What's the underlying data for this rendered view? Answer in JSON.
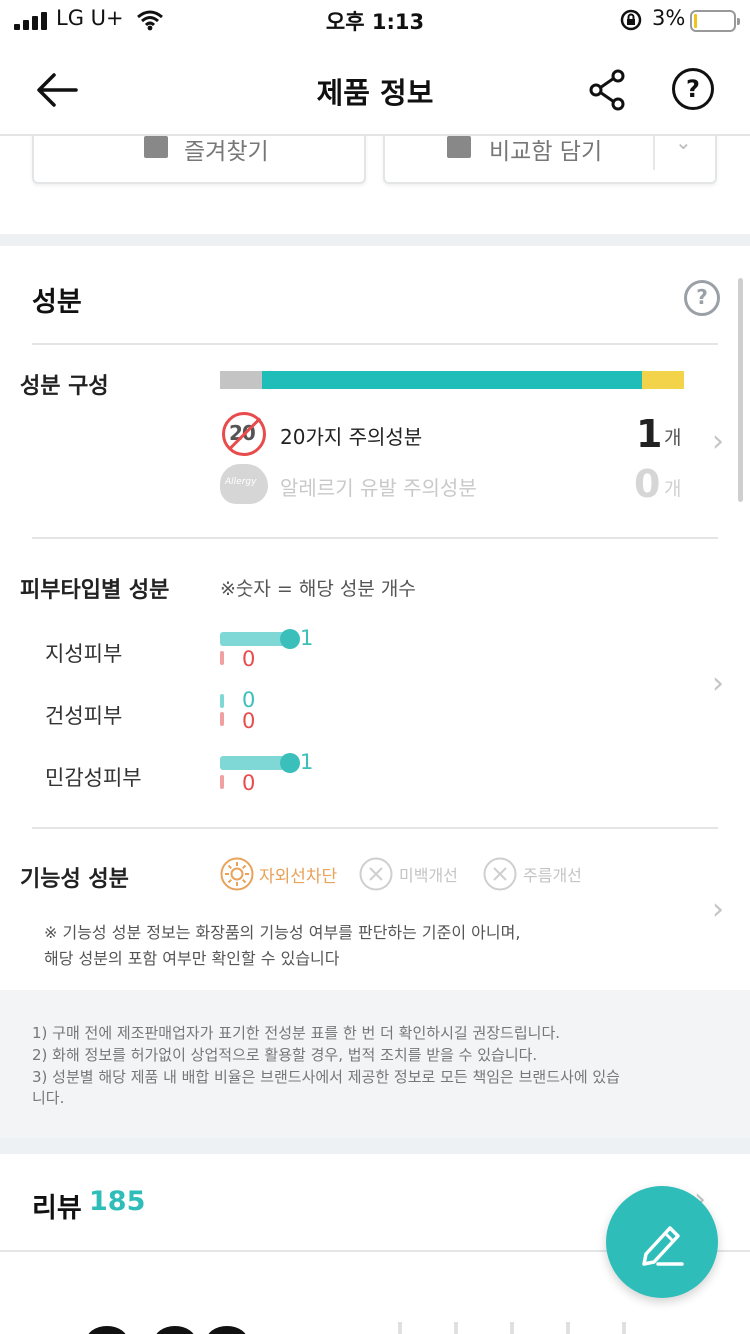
{
  "status_bar": {
    "carrier": "LG U+",
    "time": "오후 1:13",
    "battery_percent": "3%",
    "battery_level": 0.03
  },
  "nav": {
    "title": "제품 정보",
    "back_icon": "arrow-left-icon",
    "share_icon": "share-icon",
    "help_label": "?"
  },
  "actions": {
    "favorite_label": "즐겨찾기",
    "compare_label": "비교함 담기"
  },
  "ingredients": {
    "title": "성분",
    "help_label": "?",
    "composition": {
      "label": "성분 구성",
      "segments": [
        {
          "color": "#c4c4c4",
          "fraction": 0.09
        },
        {
          "color": "#21bdb8",
          "fraction": 0.82
        },
        {
          "color": "#f3d34a",
          "fraction": 0.09
        }
      ]
    },
    "caution": {
      "badge": "20",
      "label": "20가지 주의성분",
      "count": "1",
      "unit": "개"
    },
    "allergy": {
      "badge": "Allergy",
      "label": "알레르기 유발 주의성분",
      "count": "0",
      "unit": "개"
    },
    "skin_type": {
      "label": "피부타입별 성분",
      "note": "※숫자 = 해당 성분 개수",
      "rows": [
        {
          "name": "지성피부",
          "good": "1",
          "bad": "0",
          "good_value": 1,
          "bad_value": 0
        },
        {
          "name": "건성피부",
          "good": "0",
          "bad": "0",
          "good_value": 0,
          "bad_value": 0
        },
        {
          "name": "민감성피부",
          "good": "1",
          "bad": "0",
          "good_value": 1,
          "bad_value": 0
        }
      ]
    },
    "functional": {
      "label": "기능성 성분",
      "items": [
        {
          "name": "자외선차단",
          "active": true,
          "icon": "sun-icon"
        },
        {
          "name": "미백개선",
          "active": false,
          "icon": "x-circle-icon"
        },
        {
          "name": "주름개선",
          "active": false,
          "icon": "x-circle-icon"
        }
      ],
      "note_line1": "※ 기능성 성분 정보는 화장품의 기능성 여부를 판단하는 기준이 아니며,",
      "note_line2": "해당 성분의 포함 여부만 확인할 수 있습니다"
    }
  },
  "notices": {
    "line1": "1) 구매 전에 제조판매업자가 표기한 전성분 표를 한 번 더 확인하시길 권장드립니다.",
    "line2": "2) 화해 정보를 허가없이 상업적으로 활용할 경우, 법적 조치를 받을 수 있습니다.",
    "line3a": "3) 성분별 해당 제품 내 배합 비율은 브랜드사에서 제공한 정보로 모든 책임은 브랜드사에 있습",
    "line3b": "니다."
  },
  "review": {
    "title": "리뷰",
    "count": "185"
  },
  "fab": {
    "icon": "pencil-icon"
  },
  "colors": {
    "accent": "#2ebdb8",
    "caution": "#e84b4b",
    "functional_active": "#e8a25a"
  }
}
